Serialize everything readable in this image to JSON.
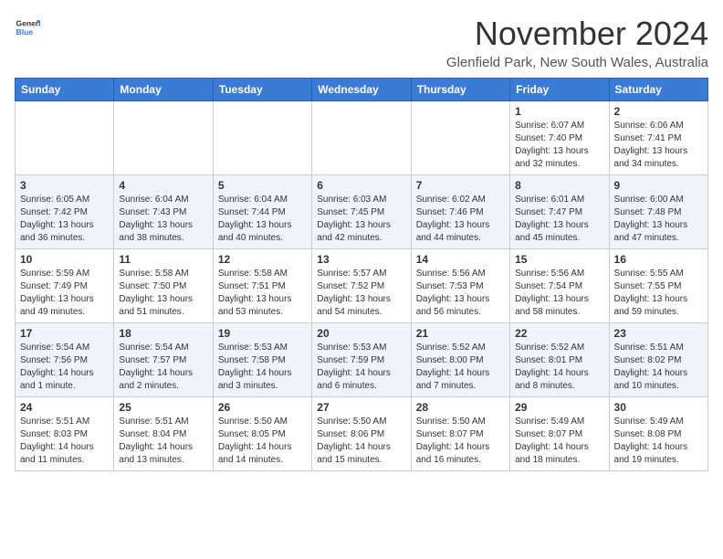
{
  "header": {
    "logo_general": "General",
    "logo_blue": "Blue",
    "month": "November 2024",
    "location": "Glenfield Park, New South Wales, Australia"
  },
  "weekdays": [
    "Sunday",
    "Monday",
    "Tuesday",
    "Wednesday",
    "Thursday",
    "Friday",
    "Saturday"
  ],
  "weeks": [
    [
      {
        "day": "",
        "info": ""
      },
      {
        "day": "",
        "info": ""
      },
      {
        "day": "",
        "info": ""
      },
      {
        "day": "",
        "info": ""
      },
      {
        "day": "",
        "info": ""
      },
      {
        "day": "1",
        "info": "Sunrise: 6:07 AM\nSunset: 7:40 PM\nDaylight: 13 hours\nand 32 minutes."
      },
      {
        "day": "2",
        "info": "Sunrise: 6:06 AM\nSunset: 7:41 PM\nDaylight: 13 hours\nand 34 minutes."
      }
    ],
    [
      {
        "day": "3",
        "info": "Sunrise: 6:05 AM\nSunset: 7:42 PM\nDaylight: 13 hours\nand 36 minutes."
      },
      {
        "day": "4",
        "info": "Sunrise: 6:04 AM\nSunset: 7:43 PM\nDaylight: 13 hours\nand 38 minutes."
      },
      {
        "day": "5",
        "info": "Sunrise: 6:04 AM\nSunset: 7:44 PM\nDaylight: 13 hours\nand 40 minutes."
      },
      {
        "day": "6",
        "info": "Sunrise: 6:03 AM\nSunset: 7:45 PM\nDaylight: 13 hours\nand 42 minutes."
      },
      {
        "day": "7",
        "info": "Sunrise: 6:02 AM\nSunset: 7:46 PM\nDaylight: 13 hours\nand 44 minutes."
      },
      {
        "day": "8",
        "info": "Sunrise: 6:01 AM\nSunset: 7:47 PM\nDaylight: 13 hours\nand 45 minutes."
      },
      {
        "day": "9",
        "info": "Sunrise: 6:00 AM\nSunset: 7:48 PM\nDaylight: 13 hours\nand 47 minutes."
      }
    ],
    [
      {
        "day": "10",
        "info": "Sunrise: 5:59 AM\nSunset: 7:49 PM\nDaylight: 13 hours\nand 49 minutes."
      },
      {
        "day": "11",
        "info": "Sunrise: 5:58 AM\nSunset: 7:50 PM\nDaylight: 13 hours\nand 51 minutes."
      },
      {
        "day": "12",
        "info": "Sunrise: 5:58 AM\nSunset: 7:51 PM\nDaylight: 13 hours\nand 53 minutes."
      },
      {
        "day": "13",
        "info": "Sunrise: 5:57 AM\nSunset: 7:52 PM\nDaylight: 13 hours\nand 54 minutes."
      },
      {
        "day": "14",
        "info": "Sunrise: 5:56 AM\nSunset: 7:53 PM\nDaylight: 13 hours\nand 56 minutes."
      },
      {
        "day": "15",
        "info": "Sunrise: 5:56 AM\nSunset: 7:54 PM\nDaylight: 13 hours\nand 58 minutes."
      },
      {
        "day": "16",
        "info": "Sunrise: 5:55 AM\nSunset: 7:55 PM\nDaylight: 13 hours\nand 59 minutes."
      }
    ],
    [
      {
        "day": "17",
        "info": "Sunrise: 5:54 AM\nSunset: 7:56 PM\nDaylight: 14 hours\nand 1 minute."
      },
      {
        "day": "18",
        "info": "Sunrise: 5:54 AM\nSunset: 7:57 PM\nDaylight: 14 hours\nand 2 minutes."
      },
      {
        "day": "19",
        "info": "Sunrise: 5:53 AM\nSunset: 7:58 PM\nDaylight: 14 hours\nand 3 minutes."
      },
      {
        "day": "20",
        "info": "Sunrise: 5:53 AM\nSunset: 7:59 PM\nDaylight: 14 hours\nand 6 minutes."
      },
      {
        "day": "21",
        "info": "Sunrise: 5:52 AM\nSunset: 8:00 PM\nDaylight: 14 hours\nand 7 minutes."
      },
      {
        "day": "22",
        "info": "Sunrise: 5:52 AM\nSunset: 8:01 PM\nDaylight: 14 hours\nand 8 minutes."
      },
      {
        "day": "23",
        "info": "Sunrise: 5:51 AM\nSunset: 8:02 PM\nDaylight: 14 hours\nand 10 minutes."
      }
    ],
    [
      {
        "day": "24",
        "info": "Sunrise: 5:51 AM\nSunset: 8:03 PM\nDaylight: 14 hours\nand 11 minutes."
      },
      {
        "day": "25",
        "info": "Sunrise: 5:51 AM\nSunset: 8:04 PM\nDaylight: 14 hours\nand 13 minutes."
      },
      {
        "day": "26",
        "info": "Sunrise: 5:50 AM\nSunset: 8:05 PM\nDaylight: 14 hours\nand 14 minutes."
      },
      {
        "day": "27",
        "info": "Sunrise: 5:50 AM\nSunset: 8:06 PM\nDaylight: 14 hours\nand 15 minutes."
      },
      {
        "day": "28",
        "info": "Sunrise: 5:50 AM\nSunset: 8:07 PM\nDaylight: 14 hours\nand 16 minutes."
      },
      {
        "day": "29",
        "info": "Sunrise: 5:49 AM\nSunset: 8:07 PM\nDaylight: 14 hours\nand 18 minutes."
      },
      {
        "day": "30",
        "info": "Sunrise: 5:49 AM\nSunset: 8:08 PM\nDaylight: 14 hours\nand 19 minutes."
      }
    ]
  ],
  "colors": {
    "header_bg": "#3a7bd5",
    "alt_row": "#eaf0fb"
  }
}
